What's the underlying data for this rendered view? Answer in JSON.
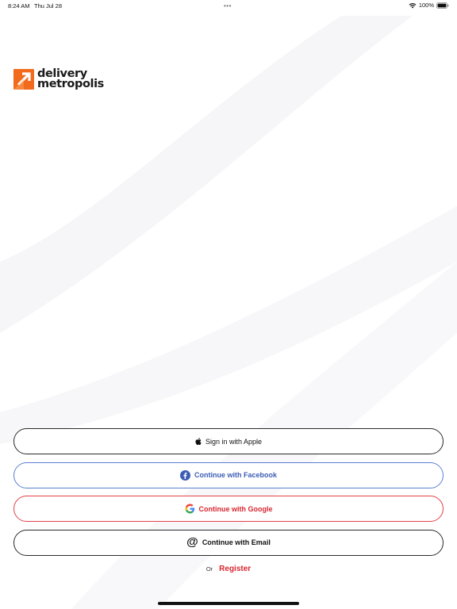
{
  "status_bar": {
    "time": "8:24 AM",
    "date": "Thu Jul 28",
    "multitask_dots": "•••",
    "battery": "100%",
    "wifi_icon": "wifi-icon",
    "battery_icon": "battery-icon"
  },
  "logo": {
    "line1": "delivery",
    "line2": "metropolis",
    "mark_color": "#f26a1b"
  },
  "buttons": {
    "apple": {
      "label": "Sign in with Apple",
      "icon": "apple-icon"
    },
    "facebook": {
      "label": "Continue with Facebook",
      "icon": "facebook-icon",
      "color": "#3b5db5"
    },
    "google": {
      "label": "Continue with Google",
      "icon": "google-icon",
      "color": "#d9262f"
    },
    "email": {
      "label": "Continue with Email",
      "icon": "at-sign-icon",
      "glyph": "@"
    }
  },
  "register": {
    "or_text": "Or",
    "link_label": "Register",
    "color": "#d9262f"
  }
}
